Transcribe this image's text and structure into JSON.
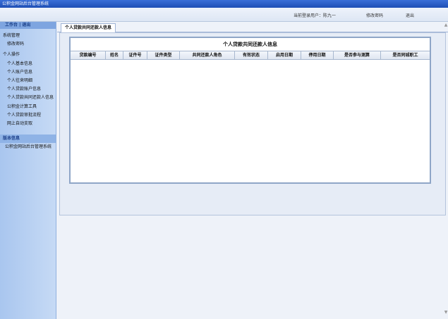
{
  "window_title": "公积金网站后台管理系统",
  "topbar": {
    "current_user": "当前登录用户：陈九一",
    "change_password": "修改密码",
    "logout": "退出"
  },
  "sidebar": {
    "header_home": "工作台",
    "header_sep": "|",
    "header_exit": "退出",
    "items": [
      {
        "label": "系统管理",
        "sub": false
      },
      {
        "label": "修改密码",
        "sub": true
      },
      {
        "label": "个人操作",
        "sub": false
      },
      {
        "label": "个人基本信息",
        "sub": true
      },
      {
        "label": "个人账户信息",
        "sub": true
      },
      {
        "label": "个人往来明细",
        "sub": true
      },
      {
        "label": "个人贷款账户信息",
        "sub": true
      },
      {
        "label": "个人贷款共同还款人信息",
        "sub": true
      },
      {
        "label": "公积金计算工具",
        "sub": true
      },
      {
        "label": "个人贷款审批流程",
        "sub": true
      },
      {
        "label": "网上自动支取",
        "sub": true
      }
    ],
    "version_header": "版本信息",
    "version_text": "公积金网站后台管理系统"
  },
  "tab": {
    "label": "个人贷款共同还款人信息"
  },
  "panel": {
    "title": "个人贷款共同还款人信息",
    "columns": [
      "贷款编号",
      "姓名",
      "证件号",
      "证件类型",
      "共同还款人角色",
      "有效状态",
      "启用日期",
      "停用日期",
      "是否参与测算",
      "是否同城职工"
    ]
  },
  "colors": {
    "titlebar": "#1e4fb5",
    "sidebar": "#a9c6ef",
    "accent": "#7ea5e0"
  }
}
